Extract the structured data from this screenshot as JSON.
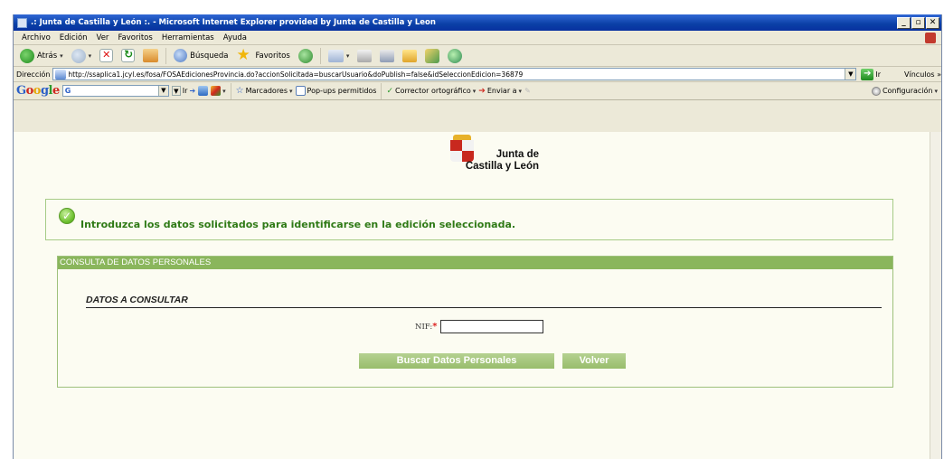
{
  "window": {
    "title": ".: Junta de Castilla y León :. - Microsoft Internet Explorer provided by Junta de Castilla y Leon",
    "controls": [
      "_",
      "▫",
      "✕"
    ]
  },
  "menu": [
    "Archivo",
    "Edición",
    "Ver",
    "Favoritos",
    "Herramientas",
    "Ayuda"
  ],
  "toolbar": {
    "back_label": "Atrás",
    "search_label": "Búsqueda",
    "favorites_label": "Favoritos"
  },
  "address": {
    "label": "Dirección",
    "url": "http://ssaplica1.jcyl.es/fosa/FOSAEdicionesProvincia.do?accionSolicitada=buscarUsuario&doPublish=false&idSeleccionEdicion=36879",
    "go_label": "Ir",
    "links_label": "Vínculos »"
  },
  "google_bar": {
    "logo": "Google",
    "search_prefix": "G",
    "ir": "Ir",
    "marcadores": "Marcadores",
    "popups": "Pop-ups permitidos",
    "corrector": "Corrector ortográfico",
    "enviar": "Enviar a",
    "configuracion": "Configuración"
  },
  "page": {
    "logo_line1": "Junta de",
    "logo_line2": "Castilla y León",
    "message": "Introduzca los datos solicitados para identificarse en la edición seleccionada.",
    "panel_title": "CONSULTA DE DATOS PERSONALES",
    "section_title": "DATOS A CONSULTAR",
    "nif_label": "NIF:",
    "nif_required": "*",
    "nif_value": "",
    "buscar_button": "Buscar Datos Personales",
    "volver_button": "Volver"
  },
  "colors": {
    "panel_header": "#8ab65c",
    "button": "#a9c982",
    "message_text": "#2f7a17",
    "titlebar": "#0a3fa6"
  }
}
